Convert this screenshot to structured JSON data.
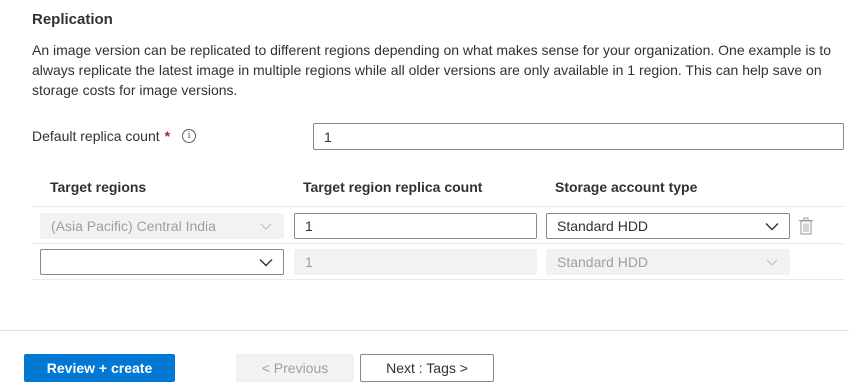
{
  "section": {
    "title": "Replication",
    "description": "An image version can be replicated to different regions depending on what makes sense for your organization. One example is to always replicate the latest image in multiple regions while all older versions are only available in 1 region. This can help save on storage costs for image versions."
  },
  "default_replica": {
    "label": "Default replica count",
    "required_mark": "*",
    "info_glyph": "i",
    "value": "1"
  },
  "table": {
    "headers": [
      "Target regions",
      "Target region replica count",
      "Storage account type"
    ],
    "rows": [
      {
        "region": "(Asia Pacific) Central India",
        "replica_count": "1",
        "storage_type": "Standard HDD"
      },
      {
        "region": "",
        "replica_count": "1",
        "storage_type": "Standard HDD"
      }
    ]
  },
  "footer": {
    "review_label": "Review + create",
    "previous_label": "< Previous",
    "next_label": "Next : Tags >"
  },
  "icons": {
    "info": "info-icon",
    "chevron": "chevron-down-icon",
    "delete": "trash-icon"
  },
  "colors": {
    "primary": "#0078d4",
    "required": "#a4262c",
    "disabled_bg": "#f3f2f1",
    "disabled_text": "#a19f9d"
  }
}
